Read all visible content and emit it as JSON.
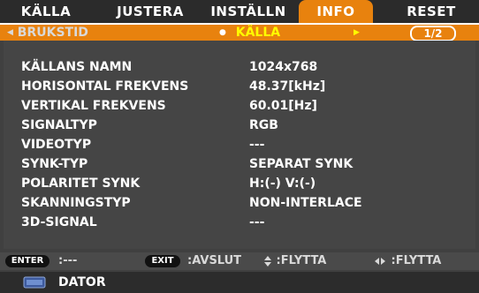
{
  "tabs": [
    {
      "label": "KÄLLA"
    },
    {
      "label": "JUSTERA"
    },
    {
      "label": "INSTÄLLN"
    },
    {
      "label": "INFO"
    },
    {
      "label": "RESET"
    }
  ],
  "subbar": {
    "prev_label": "BRUKSTID",
    "current_label": "KÄLLA",
    "page": "1/2"
  },
  "info_rows": [
    {
      "label": "KÄLLANS NAMN",
      "value": "1024x768"
    },
    {
      "label": "HORISONTAL FREKVENS",
      "value": "48.37[kHz]"
    },
    {
      "label": "VERTIKAL FREKVENS",
      "value": "60.01[Hz]"
    },
    {
      "label": "SIGNALTYP",
      "value": "RGB"
    },
    {
      "label": "VIDEOTYP",
      "value": "---"
    },
    {
      "label": "SYNK-TYP",
      "value": "SEPARAT SYNK"
    },
    {
      "label": "POLARITET SYNK",
      "value": "H:(-) V:(-)"
    },
    {
      "label": "SKANNINGSTYP",
      "value": "NON-INTERLACE"
    },
    {
      "label": "3D-SIGNAL",
      "value": "---"
    }
  ],
  "help": {
    "enter_key": "ENTER",
    "enter_text": ":---",
    "exit_key": "EXIT",
    "exit_text": ":AVSLUT",
    "updown_text": ":FLYTTA",
    "leftright_text": ":FLYTTA"
  },
  "status": {
    "source_label": "DATOR",
    "source_icon": "monitor-icon"
  }
}
